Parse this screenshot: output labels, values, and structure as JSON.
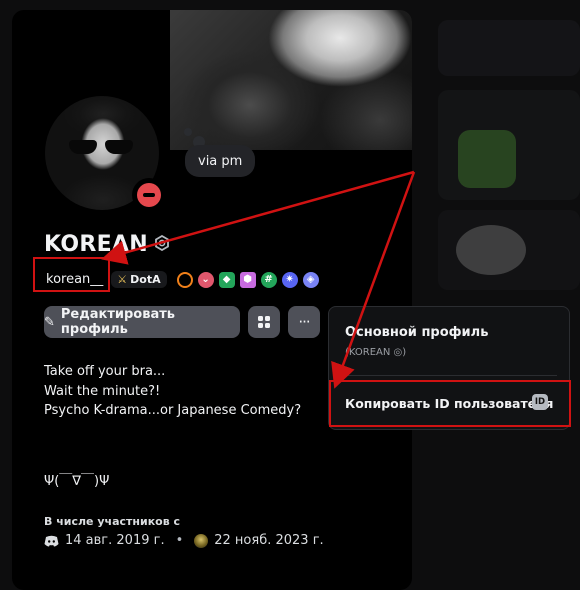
{
  "profile": {
    "display_name": "KOREAN",
    "username": "korean__",
    "guild_tag": "DotA",
    "status_bubble": "via pm",
    "status": "do-not-disturb"
  },
  "actions": {
    "edit_profile_label": "Редактировать профиль",
    "more_label": "···"
  },
  "bio": {
    "lines": [
      "Take off your bra...",
      "Wait the minute?!",
      "Psycho K-drama...or Japanese Comedy?"
    ],
    "kaomoji": "Ψ(￣∇￣)Ψ"
  },
  "membership": {
    "label": "В числе участников с",
    "discord_date": "14 авг. 2019 г.",
    "server_date": "22 нояб. 2023 г."
  },
  "context_menu": {
    "main_profile_label": "Основной профиль",
    "main_profile_sub": "(KOREAN ◎)",
    "copy_id_label": "Копировать ID пользователя",
    "id_chip": "ID"
  },
  "annotation_color": "#d01212"
}
